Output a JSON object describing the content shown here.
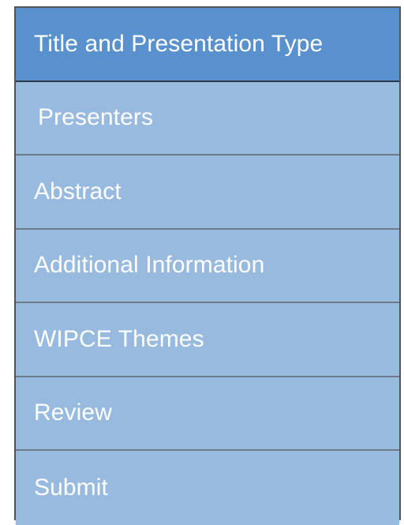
{
  "nav": {
    "items": [
      {
        "label": "Title and Presentation Type",
        "active": true
      },
      {
        "label": "Presenters",
        "active": false
      },
      {
        "label": "Abstract",
        "active": false
      },
      {
        "label": "Additional Information",
        "active": false
      },
      {
        "label": "WIPCE Themes",
        "active": false
      },
      {
        "label": "Review",
        "active": false
      },
      {
        "label": "Submit",
        "active": false
      }
    ]
  },
  "colors": {
    "active_bg": "#5891cd",
    "item_bg": "#98badf",
    "text": "#ffffff"
  }
}
